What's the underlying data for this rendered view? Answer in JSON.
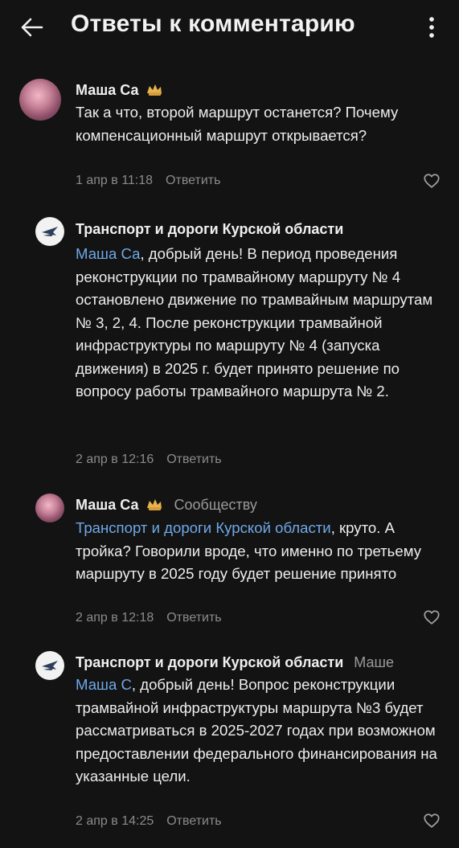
{
  "header": {
    "title": "Ответы к комментарию",
    "back_icon": "arrow-left-icon",
    "menu_icon": "more-vertical-icon"
  },
  "comments": [
    {
      "author": "Маша Са",
      "reply_to": "",
      "text": "Так а что, второй маршрут останется? Почему компенсационный маршрут открывается?",
      "mention": "",
      "mention_suffix": "",
      "date": "1 апр в 11:18",
      "reply_label": "Ответить"
    },
    {
      "author": "Транспорт и дороги Курской области",
      "reply_to": "",
      "mention": "Маша Са",
      "mention_suffix": ", добрый день!",
      "text": "В период проведения реконструкции по трамвайному маршруту № 4 остановлено движение по трамвайным маршрутам № 3, 2, 4. После реконструкции трамвайной инфраструктуры по маршруту № 4 (запуска движения) в 2025 г. будет принято решение по вопросу работы трамвайного маршрута № 2.",
      "date": "2 апр в 12:16",
      "reply_label": "Ответить"
    },
    {
      "author": "Маша Са",
      "reply_to": "Сообществу",
      "mention": "Транспорт и дороги Курской области",
      "mention_suffix": ", круто.",
      "text": "А тройка? Говорили вроде, что именно по третьему маршруту в 2025 году будет решение принято",
      "date": "2 апр в 12:18",
      "reply_label": "Ответить"
    },
    {
      "author": "Транспорт и дороги Курской области",
      "reply_to": "Маше",
      "mention": "Маша С",
      "mention_suffix": ", добрый день!",
      "text": "Вопрос реконструкции трамвайной инфраструктуры маршрута №3 будет рассматриваться в 2025-2027 годах при возможном предоставлении федерального финансирования на указанные цели.",
      "date": "2 апр в 14:25",
      "reply_label": "Ответить"
    }
  ]
}
